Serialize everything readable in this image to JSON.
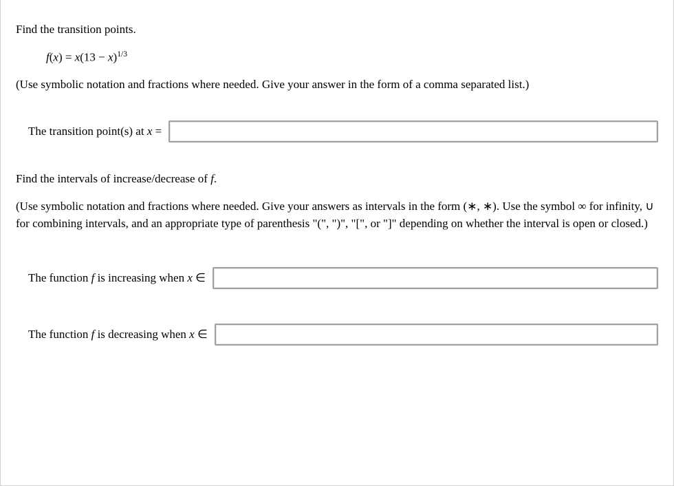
{
  "q1": {
    "prompt": "Find the transition points.",
    "formula_prefix": "f",
    "formula_open": "(",
    "formula_var": "x",
    "formula_close": ") = ",
    "formula_rhs_x": "x",
    "formula_rhs_open": "(13 − ",
    "formula_rhs_x2": "x",
    "formula_rhs_close": ")",
    "formula_exp": "1/3",
    "hint": "(Use symbolic notation and fractions where needed. Give your answer in the form of a comma separated list.)",
    "answer_label_pre": "The transition point(s) at ",
    "answer_label_var": "x",
    "answer_label_post": " ="
  },
  "q2": {
    "prompt_pre": "Find the intervals of increase/decrease of ",
    "prompt_f": "f",
    "prompt_post": ".",
    "hint": "(Use symbolic notation and fractions where needed. Give your answers as intervals in the form (∗, ∗). Use the symbol ∞ for infinity, ∪ for combining intervals, and an appropriate type of parenthesis \"(\", \")\", \"[\", or \"]\" depending on whether the interval is open or closed.)",
    "inc_label_pre": "The function ",
    "inc_label_f": "f",
    "inc_label_post": " is increasing when ",
    "inc_label_var": "x",
    "inc_label_in": " ∈",
    "dec_label_pre": "The function ",
    "dec_label_f": "f",
    "dec_label_post": " is decreasing when ",
    "dec_label_var": "x",
    "dec_label_in": " ∈"
  }
}
